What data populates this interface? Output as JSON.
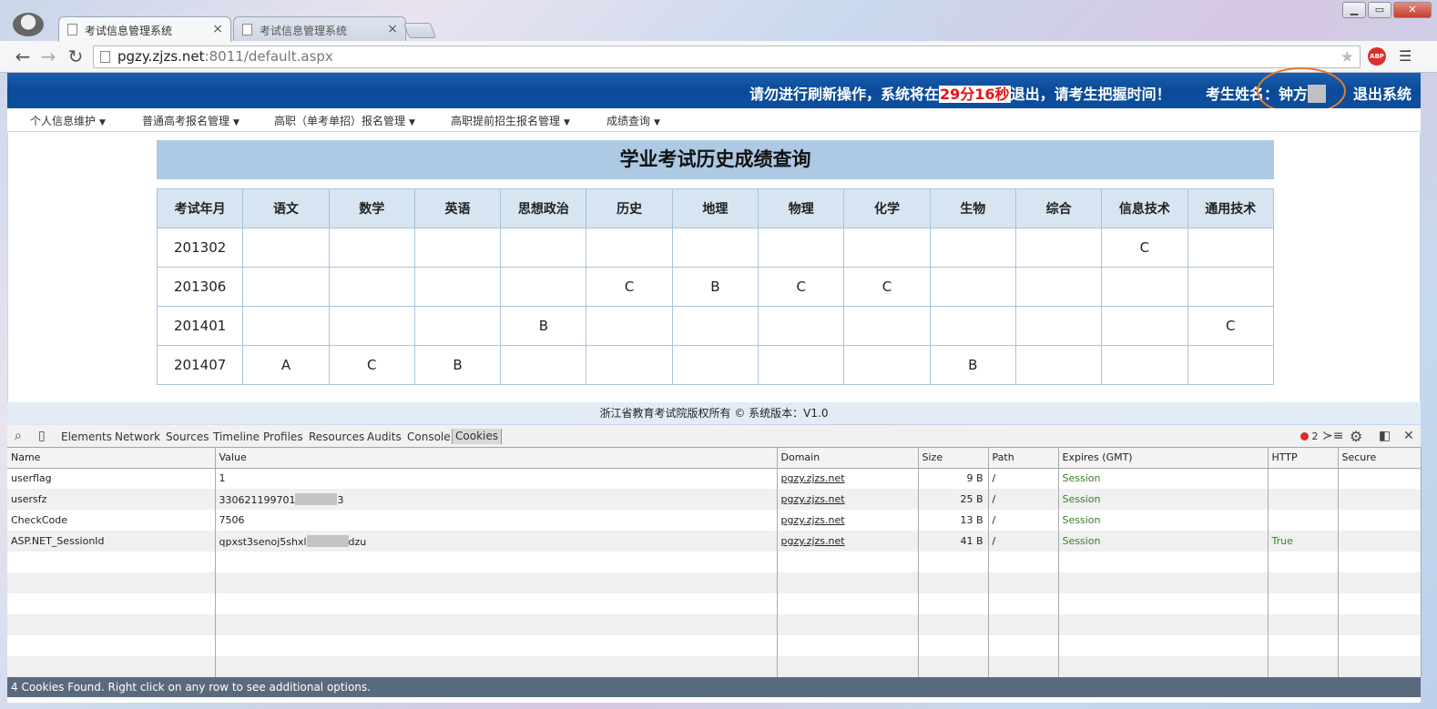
{
  "browser": {
    "tabs": [
      {
        "title": "考试信息管理系统",
        "close": "×"
      },
      {
        "title": "考试信息管理系统",
        "close": "×"
      }
    ],
    "url_host": "pgzy.zjzs.net",
    "url_rest": ":8011/default.aspx",
    "window_controls": [
      "▁",
      "▭",
      "✕"
    ],
    "abp_label": "ABP"
  },
  "header": {
    "notice_prefix": "请勿进行刷新操作，系统将在",
    "countdown": "29分16秒",
    "notice_suffix": "退出，请考生把握时间！",
    "candidate_label": "考生姓名：钟方",
    "logout": "退出系统"
  },
  "nav": {
    "items": [
      "个人信息维护",
      "普通高考报名管理",
      "高职（单考单招）报名管理",
      "高职提前招生报名管理",
      "成绩查询"
    ]
  },
  "scores": {
    "title": "学业考试历史成绩查询",
    "headers": [
      "考试年月",
      "语文",
      "数学",
      "英语",
      "思想政治",
      "历史",
      "地理",
      "物理",
      "化学",
      "生物",
      "综合",
      "信息技术",
      "通用技术"
    ],
    "rows": [
      [
        "201302",
        "",
        "",
        "",
        "",
        "",
        "",
        "",
        "",
        "",
        "",
        "C",
        ""
      ],
      [
        "201306",
        "",
        "",
        "",
        "",
        "C",
        "B",
        "C",
        "C",
        "",
        "",
        "",
        ""
      ],
      [
        "201401",
        "",
        "",
        "",
        "B",
        "",
        "",
        "",
        "",
        "",
        "",
        "",
        "C"
      ],
      [
        "201407",
        "A",
        "C",
        "B",
        "",
        "",
        "",
        "",
        "",
        "B",
        "",
        "",
        ""
      ]
    ]
  },
  "footer": {
    "text": "浙江省教育考试院版权所有 ©    系统版本：V1.0"
  },
  "devtools": {
    "tabs": [
      "Elements",
      "Network",
      "Sources",
      "Timeline",
      "Profiles",
      "Resources",
      "Audits",
      "Console",
      "Cookies"
    ],
    "error_count": "2",
    "columns": [
      "Name",
      "Value",
      "Domain",
      "Size",
      "Path",
      "Expires (GMT)",
      "HTTP",
      "Secure"
    ],
    "cookies": [
      {
        "name": "userflag",
        "value_a": "1",
        "value_b": "",
        "domain": "pgzy.zjzs.net",
        "size": "9 B",
        "path": "/",
        "expires": "Session",
        "http": "",
        "secure": ""
      },
      {
        "name": "usersfz",
        "value_a": "330621199701",
        "value_b": "3",
        "domain": "pgzy.zjzs.net",
        "size": "25 B",
        "path": "/",
        "expires": "Session",
        "http": "",
        "secure": ""
      },
      {
        "name": "CheckCode",
        "value_a": "7506",
        "value_b": "",
        "domain": "pgzy.zjzs.net",
        "size": "13 B",
        "path": "/",
        "expires": "Session",
        "http": "",
        "secure": ""
      },
      {
        "name": "ASP.NET_SessionId",
        "value_a": "qpxst3senoj5shxl",
        "value_b": "dzu",
        "domain": "pgzy.zjzs.net",
        "size": "41 B",
        "path": "/",
        "expires": "Session",
        "http": "True",
        "secure": ""
      }
    ],
    "status": "4 Cookies Found. Right click on any row to see additional options."
  }
}
